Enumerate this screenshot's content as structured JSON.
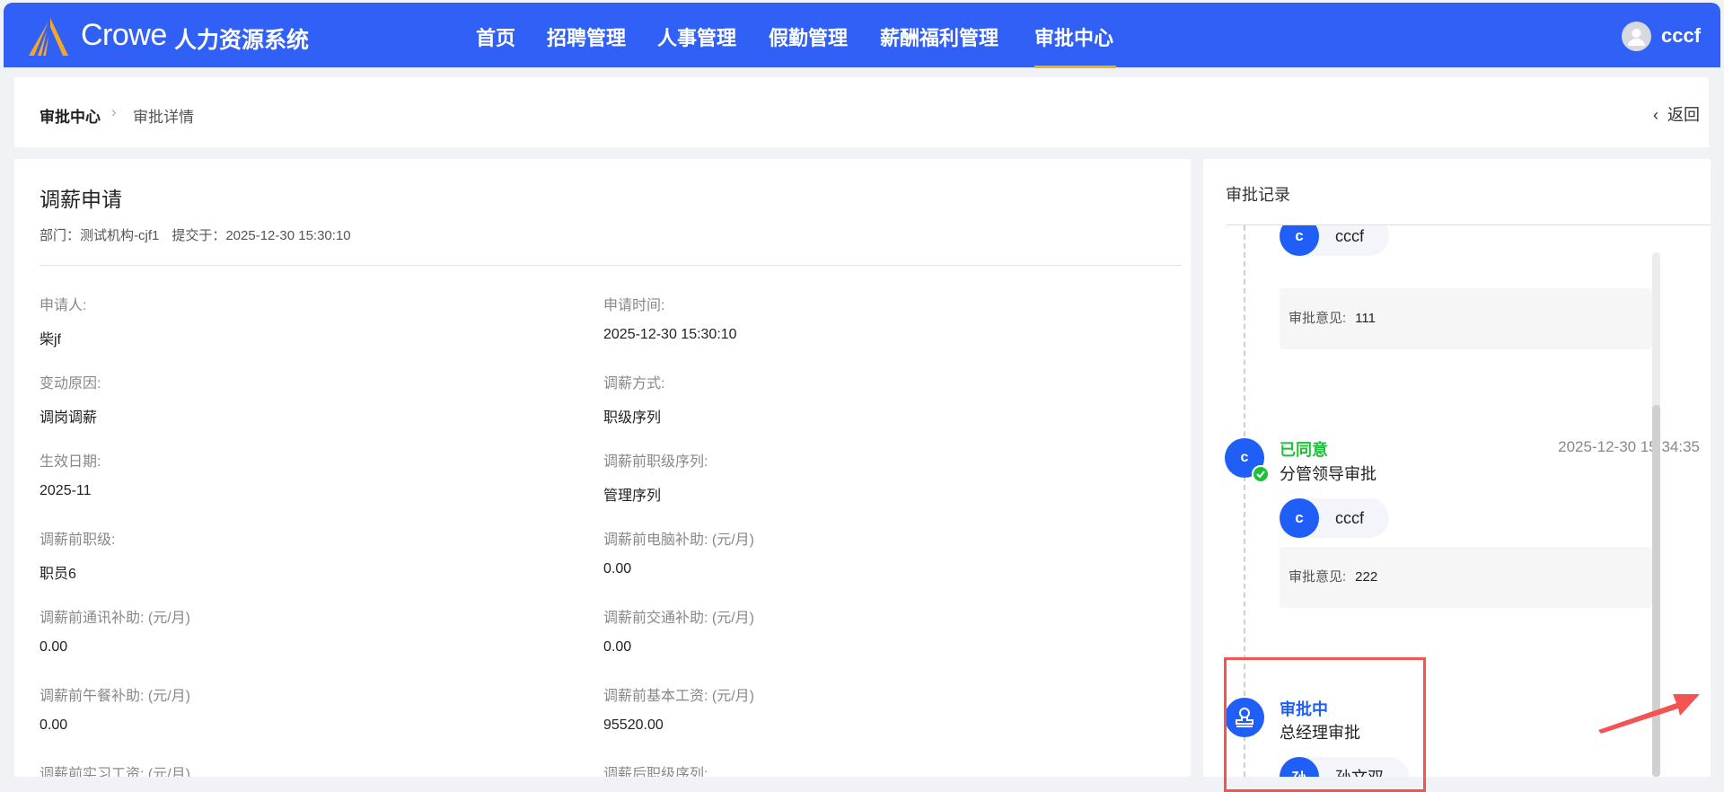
{
  "header": {
    "brand": "Crowe",
    "system_title": "人力资源系统",
    "nav": [
      "首页",
      "招聘管理",
      "人事管理",
      "假勤管理",
      "薪酬福利管理",
      "审批中心"
    ],
    "active_nav": "审批中心",
    "user": "cccf",
    "accent": "#3160f6"
  },
  "breadcrumb": {
    "root": "审批中心",
    "current": "审批详情",
    "back": "返回"
  },
  "form": {
    "title": "调薪申请",
    "department": "部门：测试机构-cjf1",
    "submitted": "提交于：2025-12-30 15:30:10",
    "fields": [
      {
        "label": "申请人:",
        "value": "柴jf"
      },
      {
        "label": "申请时间:",
        "value": "2025-12-30 15:30:10"
      },
      {
        "label": "变动原因:",
        "value": "调岗调薪"
      },
      {
        "label": "调薪方式:",
        "value": "职级序列"
      },
      {
        "label": "生效日期:",
        "value": "2025-11"
      },
      {
        "label": "调薪前职级序列:",
        "value": "管理序列"
      },
      {
        "label": "调薪前职级:",
        "value": "职员6"
      },
      {
        "label": "调薪前电脑补助: (元/月)",
        "value": "0.00"
      },
      {
        "label": "调薪前通讯补助: (元/月)",
        "value": "0.00"
      },
      {
        "label": "调薪前交通补助: (元/月)",
        "value": "0.00"
      },
      {
        "label": "调薪前午餐补助: (元/月)",
        "value": "0.00"
      },
      {
        "label": "调薪前基本工资: (元/月)",
        "value": "95520.00"
      },
      {
        "label": "调薪前实习工资: (元/月)",
        "value": ""
      },
      {
        "label": "调薪后职级序列:",
        "value": ""
      }
    ]
  },
  "records": {
    "title": "审批记录",
    "opinion_label": "审批意见:",
    "items": [
      {
        "approver": "cccf",
        "initial": "c",
        "opinion": "111"
      },
      {
        "status": "已同意",
        "step": "分管领导审批",
        "time": "2025-12-30 15:34:35",
        "initial": "c",
        "approver": "cccf",
        "opinion": "222",
        "status_color": "#1fbf3a"
      },
      {
        "status": "审批中",
        "step": "总经理审批",
        "initial": "孙",
        "approver": "孙文双",
        "status_color": "#1f5ff8"
      }
    ]
  }
}
